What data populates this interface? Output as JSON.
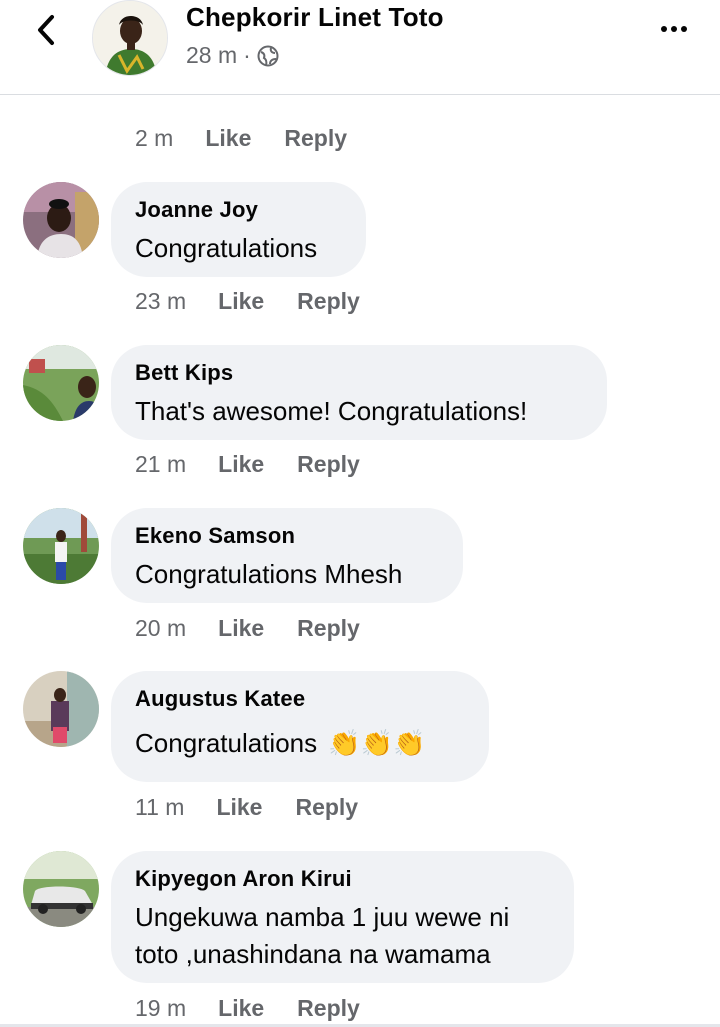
{
  "header": {
    "author": "Chepkorir Linet Toto",
    "time": "28 m",
    "separator": "·"
  },
  "top_actions": {
    "time": "2 m",
    "like": "Like",
    "reply": "Reply"
  },
  "comments": [
    {
      "name": "Joanne Joy",
      "text": "Congratulations",
      "time": "23 m",
      "like": "Like",
      "reply": "Reply"
    },
    {
      "name": "Bett Kips",
      "text": "That's awesome! Congratulations!",
      "time": "21 m",
      "like": "Like",
      "reply": "Reply"
    },
    {
      "name": "Ekeno Samson",
      "text": "Congratulations Mhesh",
      "time": "20 m",
      "like": "Like",
      "reply": "Reply"
    },
    {
      "name": "Augustus Katee",
      "text": "Congratulations",
      "emoji": "👏👏👏",
      "time": "11 m",
      "like": "Like",
      "reply": "Reply"
    },
    {
      "name": "Kipyegon Aron Kirui",
      "text_line1": "Ungekuwa namba 1 juu wewe ni",
      "text_line2": "toto ,unashindana na wamama",
      "time": "19 m",
      "like": "Like",
      "reply": "Reply"
    }
  ],
  "colors": {
    "bubble": "#f0f2f5",
    "secondary_text": "#65676b",
    "primary_text": "#050505"
  }
}
